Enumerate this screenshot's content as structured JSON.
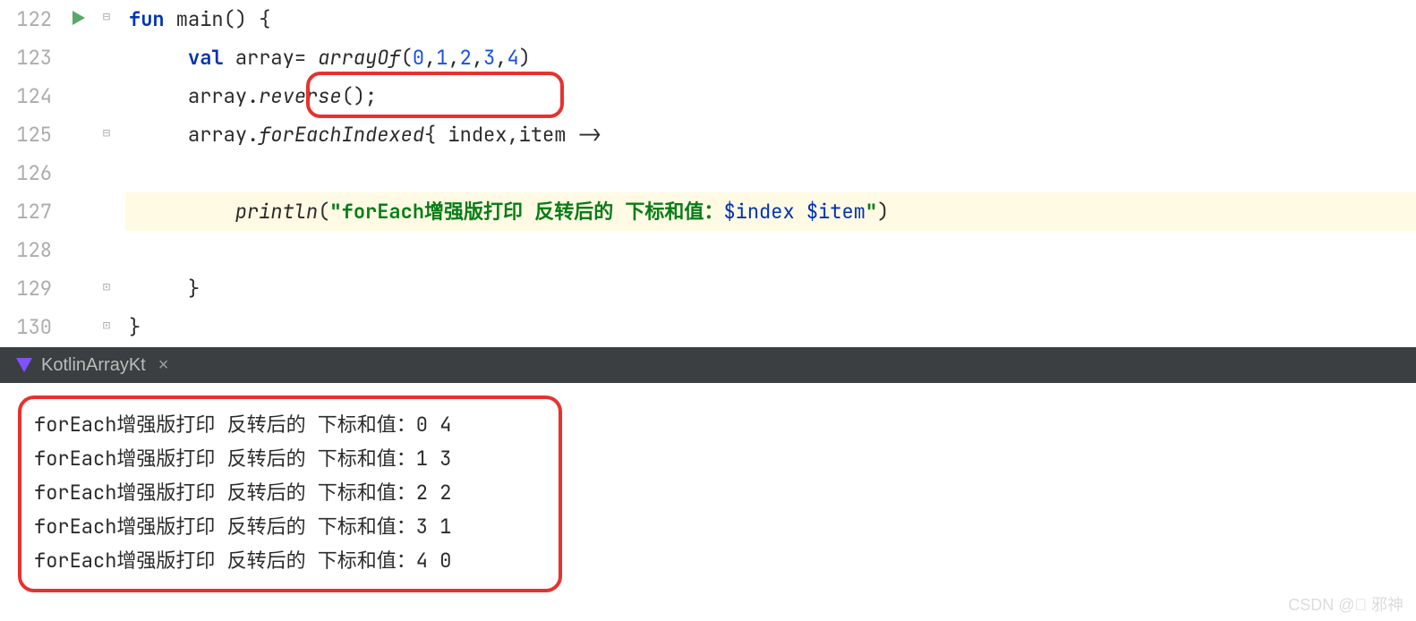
{
  "editor": {
    "lines": [
      {
        "num": "122"
      },
      {
        "num": "123"
      },
      {
        "num": "124"
      },
      {
        "num": "125"
      },
      {
        "num": "126"
      },
      {
        "num": "127"
      },
      {
        "num": "128"
      },
      {
        "num": "129"
      },
      {
        "num": "130"
      }
    ],
    "tokens": {
      "l122_fun": "fun",
      "l122_main": " main() {",
      "l123_val": "val",
      "l123_arr": " array= ",
      "l123_arrayOf": "arrayOf",
      "l123_open": "(",
      "l123_n0": "0",
      "l123_c1": ",",
      "l123_n1": "1",
      "l123_c2": ",",
      "l123_n2": "2",
      "l123_c3": ",",
      "l123_n3": "3",
      "l123_c4": ",",
      "l123_n4": "4",
      "l123_close": ")",
      "l124_pre": "array.",
      "l124_rev": "reverse",
      "l124_post": "();",
      "l125_pre": "array.",
      "l125_fei": "forEachIndexed",
      "l125_lam": "{ index,item ->",
      "l127_println": "println",
      "l127_open": "(",
      "l127_q1": "\"",
      "l127_str1": "forEach增强版打印 反转后的 下标和值：",
      "l127_t1": "$index",
      "l127_sp": " ",
      "l127_t2": "$item",
      "l127_q2": "\"",
      "l127_close": ")",
      "l129_brace": "}",
      "l130_brace": "}"
    }
  },
  "tab": {
    "title": "KotlinArrayKt",
    "close": "×"
  },
  "console": {
    "lines": [
      "forEach增强版打印 反转后的 下标和值：0 4",
      "forEach增强版打印 反转后的 下标和值：1 3",
      "forEach增强版打印 反转后的 下标和值：2 2",
      "forEach增强版打印 反转后的 下标和值：3 1",
      "forEach增强版打印 反转后的 下标和值：4 0"
    ]
  },
  "watermark": "CSDN @⃝ 邪神"
}
